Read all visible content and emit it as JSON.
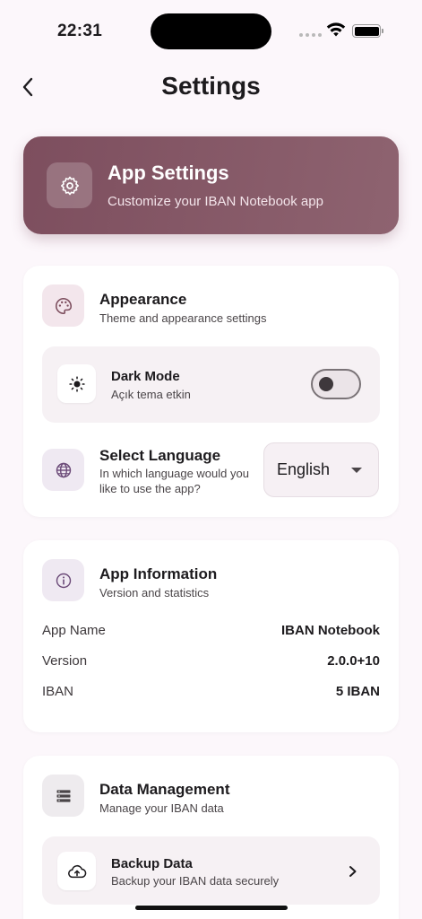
{
  "status_bar": {
    "time": "22:31"
  },
  "nav": {
    "title": "Settings"
  },
  "hero": {
    "title": "App Settings",
    "subtitle": "Customize your IBAN Notebook app",
    "icon": "gear-icon"
  },
  "appearance": {
    "title": "Appearance",
    "subtitle": "Theme and appearance settings",
    "icon": "palette-icon",
    "dark_mode": {
      "title": "Dark Mode",
      "description": "Açık tema etkin",
      "enabled": false,
      "icon": "sun-icon"
    },
    "language": {
      "title": "Select Language",
      "description_line1": "In which language would you",
      "description_line2": "like to use the app?",
      "selected": "English",
      "icon": "globe-icon"
    }
  },
  "app_info": {
    "title": "App Information",
    "subtitle": "Version and statistics",
    "icon": "info-icon",
    "rows": [
      {
        "label": "App Name",
        "value": "IBAN Notebook"
      },
      {
        "label": "Version",
        "value": "2.0.0+10"
      },
      {
        "label": "IBAN",
        "value": "5 IBAN"
      }
    ]
  },
  "data_management": {
    "title": "Data Management",
    "subtitle": "Manage your IBAN data",
    "icon": "storage-icon",
    "backup": {
      "title": "Backup Data",
      "description": "Backup your IBAN data securely",
      "icon": "cloud-upload-icon"
    }
  },
  "colors": {
    "accent": "#7d4e5e",
    "background": "#fcf7fb",
    "card": "#ffffff",
    "icon_tint": "#6b4a78"
  }
}
